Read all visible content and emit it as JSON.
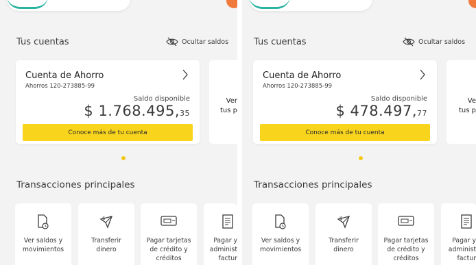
{
  "accounts_section": {
    "title": "Tus cuentas",
    "hide_balances_label": "Ocultar saldos"
  },
  "screens": [
    {
      "account": {
        "name": "Cuenta de Ahorro",
        "number": "Ahorros 120-273885-99",
        "balance_label": "Saldo disponible",
        "balance_main": "$ 1.768.495,",
        "balance_cents": "35",
        "cta_label": "Conoce más de tu cuenta"
      },
      "peek_text_line1": "Ver",
      "peek_text_line2": "tus p"
    },
    {
      "account": {
        "name": "Cuenta de Ahorro",
        "number": "Ahorros 120-273885-99",
        "balance_label": "Saldo disponible",
        "balance_main": "$ 478.497,",
        "balance_cents": "77",
        "cta_label": "Conoce más de tu cuenta"
      },
      "peek_text_line1": "Ve",
      "peek_text_line2": "tus p"
    }
  ],
  "transactions_section": {
    "title": "Transacciones principales",
    "tiles": [
      {
        "icon": "document-clock-icon",
        "line1": "Ver saldos y",
        "line2": "movimientos",
        "line3": ""
      },
      {
        "icon": "transfer-money-icon",
        "line1": "Transferir",
        "line2": "dinero",
        "line3": ""
      },
      {
        "icon": "credit-card-icon",
        "line1": "Pagar tarjetas",
        "line2": "de crédito y",
        "line3": "créditos"
      },
      {
        "icon": "bill-icon",
        "line1": "Pagar y",
        "line2": "administ",
        "line3": "factur"
      }
    ]
  },
  "colors": {
    "accent_yellow": "#f8d51c",
    "dot_yellow": "#f3c918",
    "top_orange": "#f07a3c",
    "top_teal": "#29b3a0",
    "background": "#f3f3f3"
  }
}
